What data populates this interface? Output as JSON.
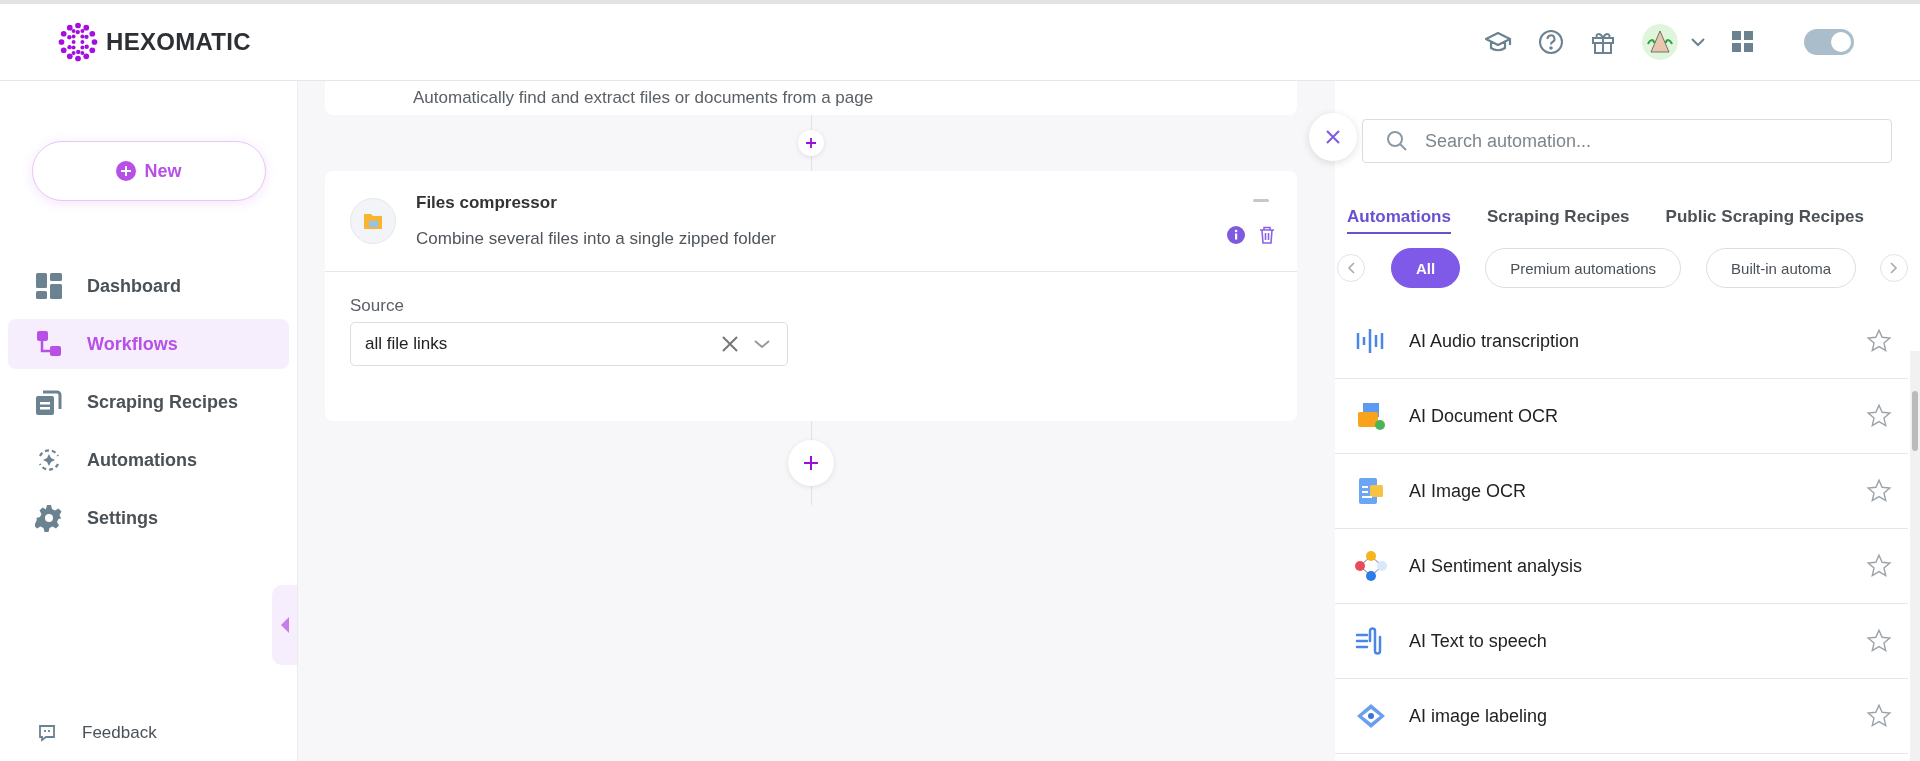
{
  "brand": {
    "name": "HEXOMATIC"
  },
  "header": {
    "toggle": {
      "on": true
    }
  },
  "sidebar": {
    "new_button": "New",
    "items": [
      {
        "label": "Dashboard",
        "selected": false
      },
      {
        "label": "Workflows",
        "selected": true
      },
      {
        "label": "Scraping Recipes",
        "selected": false
      },
      {
        "label": "Automations",
        "selected": false
      },
      {
        "label": "Settings",
        "selected": false
      }
    ],
    "feedback": "Feedback"
  },
  "workflow": {
    "previous_step": {
      "description": "Automatically find and extract files or documents from a page"
    },
    "step": {
      "title": "Files compressor",
      "description": "Combine several files into a single zipped folder",
      "source_label": "Source",
      "source_value": "all file links"
    }
  },
  "panel": {
    "search": {
      "placeholder": "Search automation..."
    },
    "tabs": [
      {
        "label": "Automations",
        "selected": true
      },
      {
        "label": "Scraping Recipes",
        "selected": false
      },
      {
        "label": "Public Scraping Recipes",
        "selected": false
      }
    ],
    "chips": [
      {
        "label": "All",
        "selected": true
      },
      {
        "label": "Premium automations",
        "selected": false
      },
      {
        "label": "Built-in automa",
        "selected": false
      }
    ],
    "automations": [
      {
        "name": "AI Audio transcription",
        "favorite": false
      },
      {
        "name": "AI Document OCR",
        "favorite": false
      },
      {
        "name": "AI Image OCR",
        "favorite": false
      },
      {
        "name": "AI Sentiment analysis",
        "favorite": false
      },
      {
        "name": "AI Text to speech",
        "favorite": false
      },
      {
        "name": "AI image labeling",
        "favorite": false
      }
    ]
  }
}
